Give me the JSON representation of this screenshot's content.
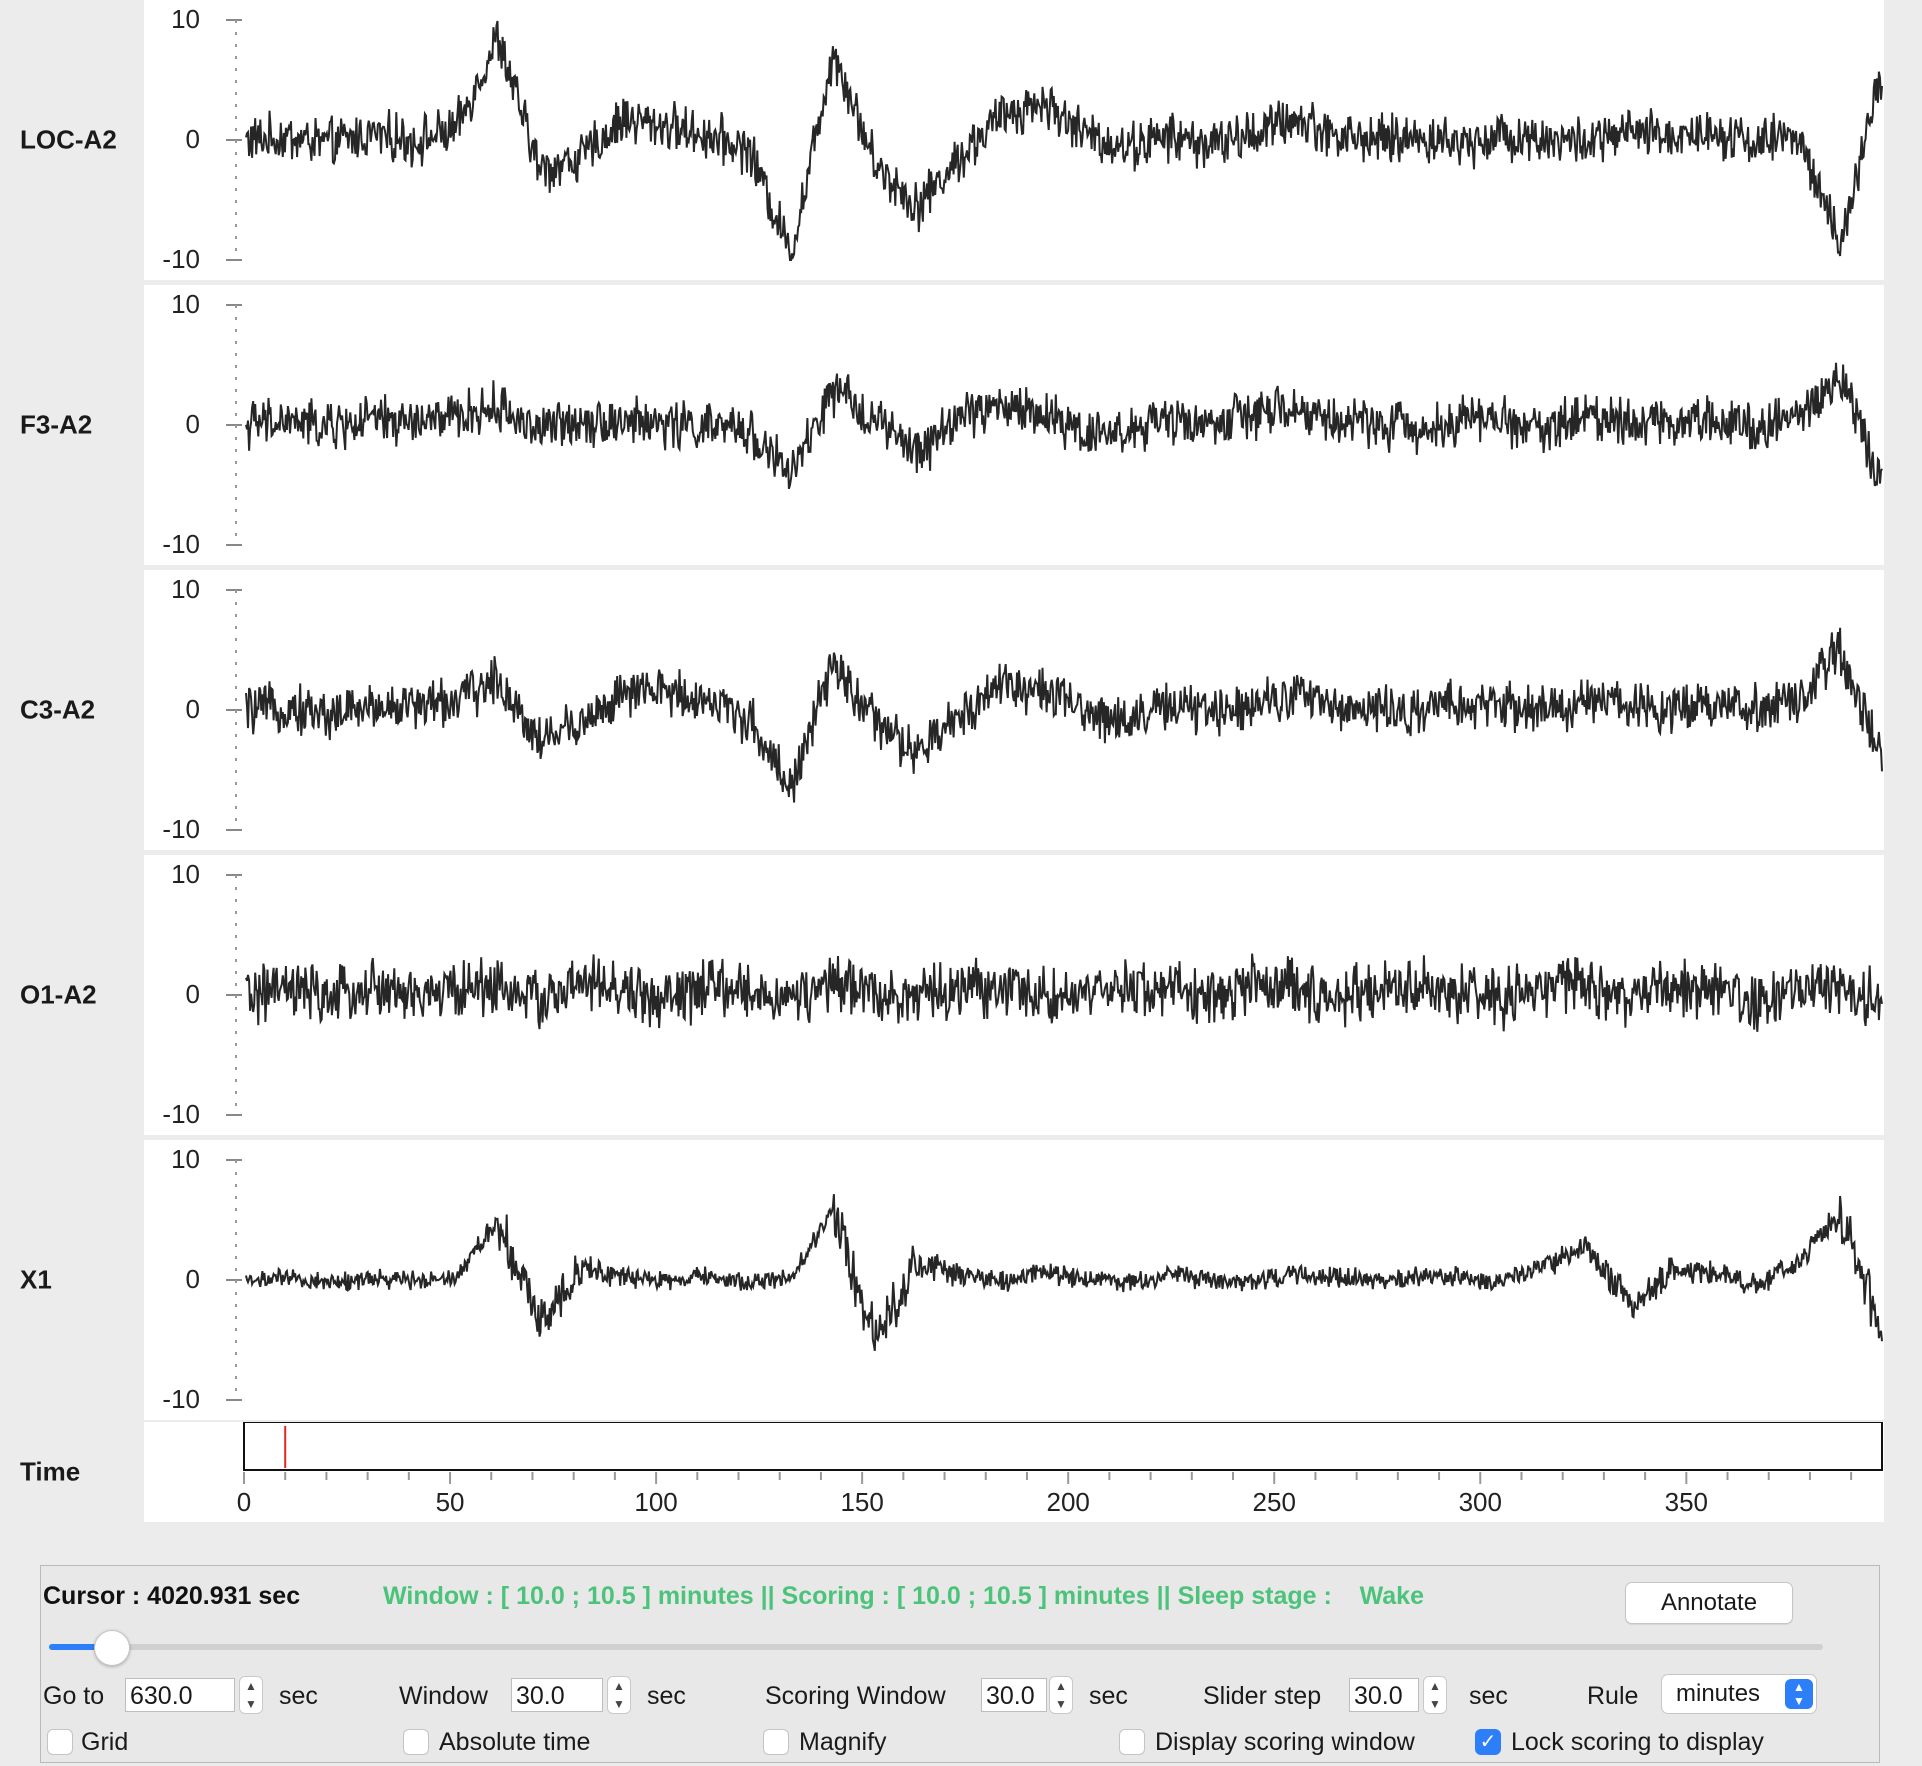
{
  "channels": [
    {
      "label": "LOC-A2",
      "y_ticks": [
        "10",
        "0",
        "-10"
      ]
    },
    {
      "label": "F3-A2",
      "y_ticks": [
        "10",
        "0",
        "-10"
      ]
    },
    {
      "label": "C3-A2",
      "y_ticks": [
        "10",
        "0",
        "-10"
      ]
    },
    {
      "label": "O1-A2",
      "y_ticks": [
        "10",
        "0",
        "-10"
      ]
    },
    {
      "label": "X1",
      "y_ticks": [
        "10",
        "0",
        "-10"
      ]
    }
  ],
  "time_axis": {
    "label": "Time",
    "ticks": [
      "0",
      "50",
      "100",
      "150",
      "200",
      "250",
      "300",
      "350"
    ],
    "x_max": 397,
    "cursor_marker_at": 10
  },
  "chart_data": {
    "type": "line",
    "ylim": [
      -10,
      10
    ],
    "xlim": [
      0,
      397
    ],
    "series": [
      {
        "name": "LOC-A2",
        "values": [
          0,
          0.2,
          -0.3,
          0.5,
          -0.1,
          0.8,
          8.5,
          -2.5,
          -1.5,
          1.8,
          1.2,
          0.4,
          -0.8,
          -9.5,
          7.5,
          -2,
          -5.5,
          -1.5,
          2,
          3.2,
          0.5,
          -0.6,
          0.3,
          -0.4,
          0.5,
          1.8,
          0.4,
          0,
          0.2,
          -0.3,
          0.4,
          0.1,
          -0.2,
          0.6,
          0.3,
          0.8,
          -0.2,
          0.4,
          -8.8,
          5.5
        ]
      },
      {
        "name": "F3-A2",
        "values": [
          0,
          0.3,
          -0.2,
          0.4,
          0.2,
          0.6,
          1.5,
          -0.4,
          0.5,
          0.3,
          0.1,
          -0.2,
          -0.5,
          -4.2,
          2.8,
          0.5,
          -2.5,
          0.8,
          1.6,
          0.9,
          -0.5,
          -0.6,
          0.4,
          0.1,
          0.9,
          1.2,
          0.3,
          0.2,
          -0.4,
          0.6,
          0.4,
          -0.3,
          0.8,
          0.5,
          0.2,
          0.6,
          -0.1,
          0.8,
          4.2,
          -5
        ]
      },
      {
        "name": "C3-A2",
        "values": [
          0,
          0.2,
          -0.4,
          0.3,
          0.4,
          0.8,
          2.5,
          -2.5,
          -1,
          1.2,
          1.6,
          0.8,
          -0.8,
          -6.5,
          3.8,
          -1,
          -3.8,
          -0.5,
          2.4,
          1.5,
          -0.2,
          -0.8,
          0.3,
          -0.2,
          0.7,
          1.4,
          0.2,
          0.1,
          -0.3,
          0.5,
          0.3,
          -0.1,
          0.7,
          0.4,
          0.3,
          0.5,
          0.1,
          0.6,
          5,
          -4
        ]
      },
      {
        "name": "O1-A2",
        "values": [
          0,
          0.4,
          -0.3,
          0.6,
          -0.2,
          0.5,
          0.8,
          -0.4,
          0.9,
          0.3,
          -0.5,
          0.6,
          0.2,
          -0.3,
          0.7,
          0.4,
          -0.3,
          0.5,
          0.6,
          0.1,
          -0.4,
          0.7,
          0.5,
          -0.2,
          0.9,
          0.6,
          -0.3,
          0.5,
          0.7,
          0.2,
          -0.4,
          0.6,
          0.8,
          -0.2,
          0.5,
          0.3,
          -0.5,
          0.4,
          0.3,
          -0.3
        ]
      },
      {
        "name": "X1",
        "values": [
          0,
          0.1,
          -0.2,
          0.1,
          0,
          0.3,
          5,
          -3.5,
          1.2,
          0.2,
          -0.1,
          0.3,
          -0.2,
          0.1,
          6,
          -5,
          1.5,
          0.4,
          -0.2,
          0.6,
          0.2,
          -0.3,
          0.5,
          0.1,
          -0.2,
          0.4,
          0.3,
          -0.1,
          0.3,
          0.2,
          -0.2,
          1.2,
          2.8,
          -2.2,
          0.8,
          0.6,
          -0.5,
          1.4,
          5.5,
          -4
        ]
      }
    ]
  },
  "controls": {
    "cursor_text": "Cursor : 4020.931 sec",
    "status_text": "Window : [ 10.0 ; 10.5 ] minutes || Scoring : [ 10.0 ; 10.5 ] minutes || Sleep stage :    Wake",
    "annotate_label": "Annotate",
    "slider_fraction": 0.028,
    "goto_label": "Go to",
    "goto_value": "630.0",
    "window_label": "Window",
    "window_value": "30.0",
    "scoring_window_label": "Scoring Window",
    "scoring_window_value": "30.0",
    "slider_step_label": "Slider step",
    "slider_step_value": "30.0",
    "sec_unit": "sec",
    "rule_label": "Rule",
    "rule_value": "minutes",
    "checkboxes": [
      {
        "label": "Grid",
        "checked": false
      },
      {
        "label": "Absolute time",
        "checked": false
      },
      {
        "label": "Magnify",
        "checked": false
      },
      {
        "label": "Display scoring window",
        "checked": false
      },
      {
        "label": "Lock scoring to display",
        "checked": true
      }
    ]
  },
  "colors": {
    "accent": "#2d7ff9",
    "status_text": "#4cc37a",
    "trace": "#262626",
    "marker": "#e0281e"
  }
}
